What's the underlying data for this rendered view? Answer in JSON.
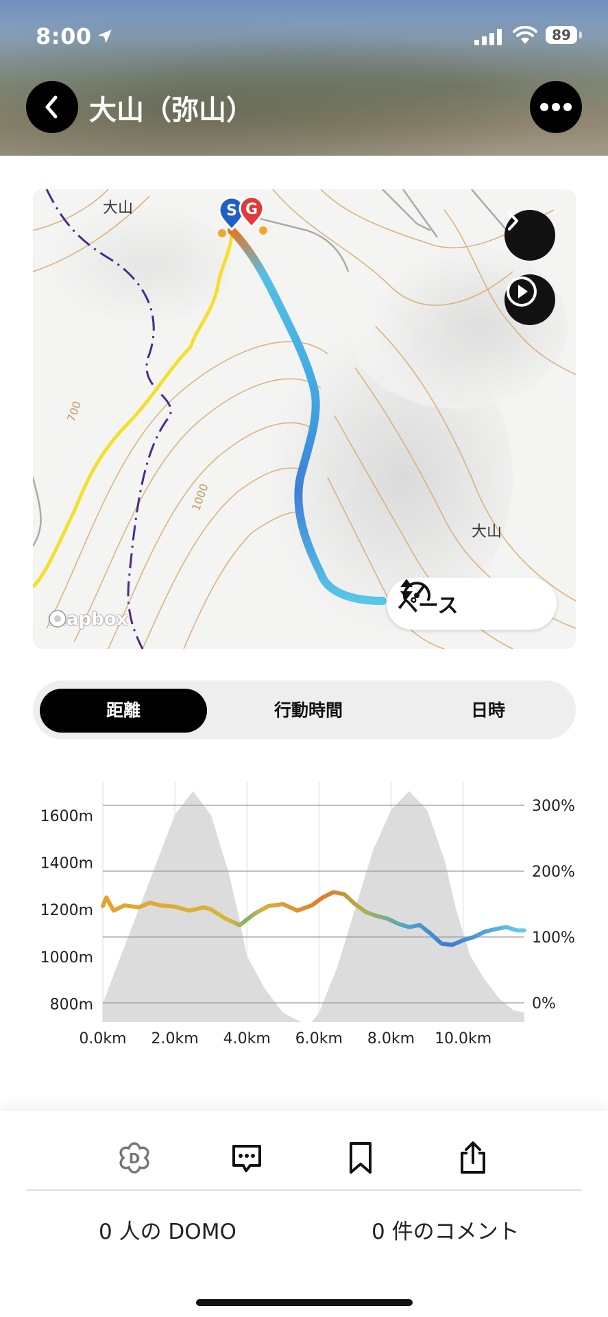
{
  "status_bar": {
    "time": "8:00",
    "battery": "89"
  },
  "header": {
    "title": "大山（弥山）"
  },
  "map": {
    "labels": {
      "top_left": "大山",
      "bottom_right": "大山",
      "contour_700": "700",
      "contour_1000": "1000"
    },
    "start_marker": "S",
    "goal_marker": "G",
    "pace_label": "ペース",
    "attribution": "mapbox"
  },
  "tabs": [
    {
      "label": "距離",
      "active": true
    },
    {
      "label": "行動時間",
      "active": false
    },
    {
      "label": "日時",
      "active": false
    }
  ],
  "chart_data": {
    "type": "line",
    "x_unit": "km",
    "x_ticks": [
      "0.0km",
      "2.0km",
      "4.0km",
      "6.0km",
      "8.0km",
      "10.0km"
    ],
    "x_range": [
      0,
      11.7
    ],
    "y_left_ticks": [
      "1600m",
      "1400m",
      "1200m",
      "1000m",
      "800m"
    ],
    "y_left_range": [
      720,
      1710
    ],
    "y_right_ticks": [
      "300%",
      "200%",
      "100%",
      "0%"
    ],
    "y_right_range": [
      0,
      300
    ],
    "series": [
      {
        "axis": "left",
        "x": [
          0,
          0.5,
          1.0,
          1.5,
          2.0,
          2.5,
          3.0,
          3.5,
          3.8,
          4.0,
          4.5,
          5.0,
          5.5,
          5.8,
          6.0,
          6.5,
          7.0,
          7.5,
          8.0,
          8.5,
          9.0,
          9.5,
          9.8,
          10.2,
          10.6,
          11.0,
          11.4,
          11.7
        ],
        "y": [
          800,
          1000,
          1200,
          1400,
          1600,
          1700,
          1600,
          1350,
          1150,
          1000,
          860,
          760,
          720,
          720,
          760,
          950,
          1200,
          1450,
          1620,
          1700,
          1620,
          1400,
          1200,
          1000,
          900,
          820,
          770,
          760
        ]
      },
      {
        "axis": "right",
        "x": [
          0,
          0.1,
          0.3,
          0.6,
          1.0,
          1.3,
          1.6,
          2.0,
          2.4,
          2.8,
          3.0,
          3.4,
          3.8,
          4.2,
          4.6,
          5.0,
          5.4,
          5.8,
          6.1,
          6.4,
          6.7,
          7.0,
          7.3,
          7.6,
          7.9,
          8.2,
          8.5,
          8.8,
          9.1,
          9.4,
          9.7,
          10.0,
          10.3,
          10.6,
          10.9,
          11.2,
          11.5,
          11.7
        ],
        "y": [
          147,
          160,
          140,
          148,
          145,
          152,
          148,
          146,
          140,
          145,
          142,
          128,
          118,
          135,
          147,
          150,
          140,
          148,
          160,
          168,
          165,
          150,
          138,
          132,
          128,
          120,
          115,
          118,
          105,
          90,
          88,
          95,
          100,
          108,
          112,
          115,
          110,
          110
        ]
      }
    ],
    "grid": true
  },
  "bottom_bar": {
    "domo_count": "0 人の DOMO",
    "comment_count": "0 件のコメント"
  }
}
